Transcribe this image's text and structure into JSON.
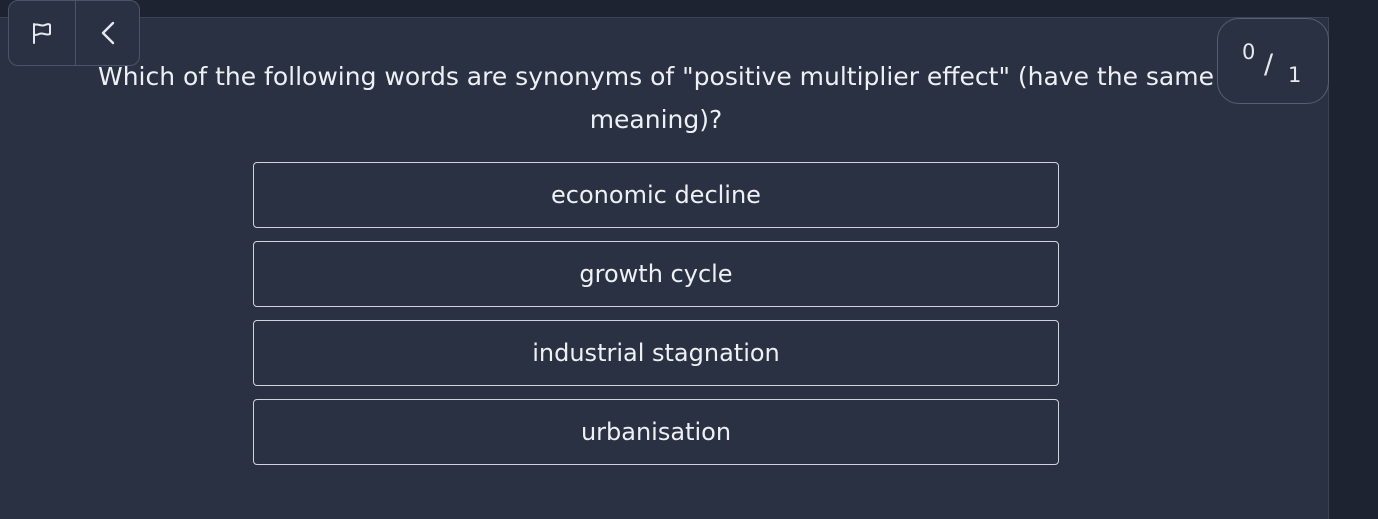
{
  "question": {
    "text": "Which of the following words are synonyms of \"positive multiplier effect\" (have the same meaning)?"
  },
  "progress": {
    "current": "0",
    "separator": "/",
    "total": "1"
  },
  "nav": {
    "flag_icon": "flag-icon",
    "back_icon": "chevron-left-icon"
  },
  "options": [
    {
      "label": "economic decline"
    },
    {
      "label": "growth cycle"
    },
    {
      "label": "industrial stagnation"
    },
    {
      "label": "urbanisation"
    }
  ],
  "colors": {
    "background": "#1d2330",
    "panel": "#2a3142",
    "option_border": "#cfd3db",
    "text": "#eef0f4"
  }
}
